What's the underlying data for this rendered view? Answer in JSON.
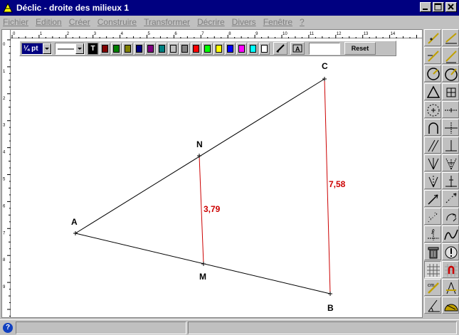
{
  "window": {
    "title": "Déclic - droite des milieux 1"
  },
  "menu": [
    "Fichier",
    "Edition",
    "Créer",
    "Construire",
    "Transformer",
    "Décrire",
    "Divers",
    "Fenêtre",
    "?"
  ],
  "style_toolbar": {
    "line_width": "¼ pt",
    "text_swatch": "T",
    "colors": [
      "#800000",
      "#008000",
      "#808000",
      "#000080",
      "#800080",
      "#008080",
      "#c0c0c0",
      "#808080",
      "#ff0000",
      "#00ff00",
      "#ffff00",
      "#0000ff",
      "#ff00ff",
      "#00ffff",
      "#ffffff"
    ],
    "reset_label": "Reset"
  },
  "figure": {
    "points": {
      "A": "A",
      "B": "B",
      "C": "C",
      "M": "M",
      "N": "N"
    },
    "measure_MN": "3,79",
    "measure_BC": "7,58",
    "measure_color": "#cc0000"
  },
  "ruler": {
    "top_ticks": [
      "0",
      "1",
      "2",
      "3",
      "4",
      "5",
      "6",
      "7",
      "8",
      "9",
      "10",
      "11",
      "12",
      "13",
      "14"
    ],
    "left_ticks": [
      "0",
      "1",
      "2",
      "3",
      "4",
      "5",
      "6",
      "7",
      "8",
      "9"
    ]
  }
}
